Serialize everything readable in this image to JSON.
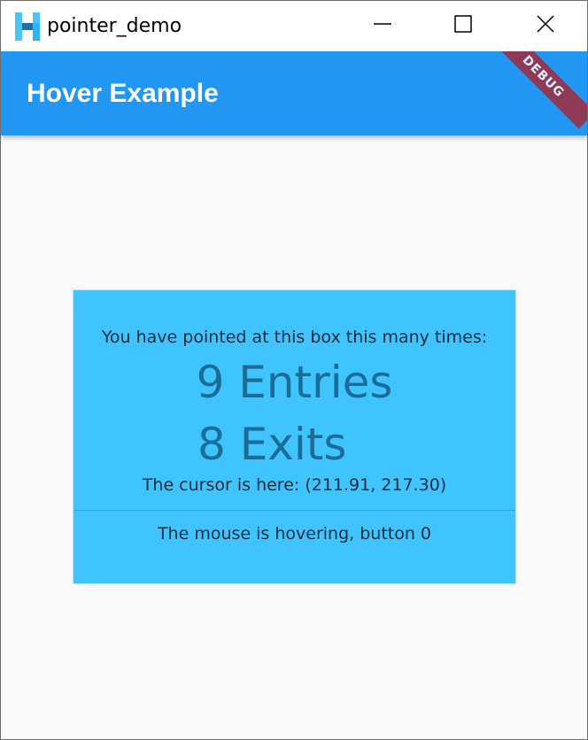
{
  "window": {
    "title": "pointer_demo",
    "app_icon": "flutter-h-icon",
    "controls": {
      "minimize_icon": "minimize-icon",
      "maximize_icon": "maximize-icon",
      "close_icon": "close-icon"
    }
  },
  "appbar": {
    "title": "Hover Example",
    "color": "#2196f3",
    "debug_banner": "DEBUG"
  },
  "hover_box": {
    "color": "#40c4ff",
    "intro": "You have pointed at this box this many times:",
    "entries": "9 Entries",
    "exits": "8 Exits",
    "cursor": "The cursor is here: (211.91, 217.30)",
    "status": "The mouse is hovering, button 0"
  }
}
